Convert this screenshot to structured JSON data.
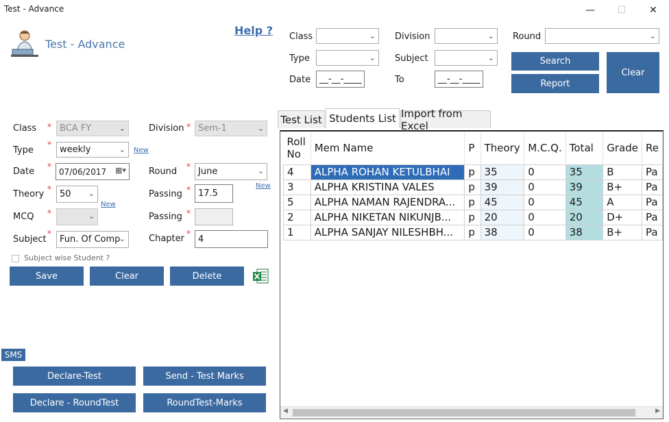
{
  "window": {
    "title": "Test - Advance",
    "minimize": "—",
    "maximize": "☐",
    "close": "✕"
  },
  "header": {
    "title": "Test - Advance",
    "help": "Help ?"
  },
  "filters": {
    "class_label": "Class",
    "division_label": "Division",
    "round_label": "Round",
    "type_label": "Type",
    "subject_label": "Subject",
    "date_label": "Date",
    "to_label": "To",
    "date_value": "__-__-____",
    "to_value": "__-__-____",
    "search": "Search",
    "report": "Report",
    "clear": "Clear"
  },
  "form": {
    "class_label": "Class",
    "class_value": "BCA FY",
    "division_label": "Division",
    "division_value": "Sem-1",
    "type_label": "Type",
    "type_value": "weekly",
    "date_label": "Date",
    "date_value": "07/06/2017",
    "round_label": "Round",
    "round_value": "June",
    "theory_label": "Theory",
    "theory_value": "50",
    "passing_label": "Passing",
    "passing_value": "17.5",
    "mcq_label": "MCQ",
    "mcq_value": "",
    "passing2_label": "Passing",
    "passing2_value": "",
    "subject_label": "Subject",
    "subject_value": "Fun. Of Comp",
    "chapter_label": "Chapter",
    "chapter_value": "4",
    "new_link": "New",
    "subject_wise": "Subject wise Student ?",
    "save": "Save",
    "clear": "Clear",
    "delete": "Delete",
    "req": "*"
  },
  "sms": {
    "label": "SMS",
    "declare_test": "Declare-Test",
    "send_test_marks": "Send - Test Marks",
    "declare_round": "Declare - RoundTest",
    "round_marks": "RoundTest-Marks"
  },
  "tabs": [
    {
      "label": "Test List"
    },
    {
      "label": "Students List"
    },
    {
      "label": "Import from Excel"
    }
  ],
  "grid": {
    "headers": {
      "roll": "Roll No",
      "name": "Mem Name",
      "p": "P",
      "theory": "Theory",
      "mcq": "M.C.Q.",
      "total": "Total",
      "grade": "Grade",
      "result": "Re"
    },
    "rows": [
      {
        "roll": "4",
        "name": "ALPHA ROHAN KETULBHAI",
        "p": "p",
        "theory": "35",
        "mcq": "0",
        "total": "35",
        "grade": "B",
        "result": "Pa"
      },
      {
        "roll": "3",
        "name": "ALPHA KRISTINA VALES",
        "p": "p",
        "theory": "39",
        "mcq": "0",
        "total": "39",
        "grade": "B+",
        "result": "Pa"
      },
      {
        "roll": "5",
        "name": "ALPHA NAMAN RAJENDRA...",
        "p": "p",
        "theory": "45",
        "mcq": "0",
        "total": "45",
        "grade": "A",
        "result": "Pa"
      },
      {
        "roll": "2",
        "name": "ALPHA NIKETAN NIKUNJB...",
        "p": "p",
        "theory": "20",
        "mcq": "0",
        "total": "20",
        "grade": "D+",
        "result": "Pa"
      },
      {
        "roll": "1",
        "name": "ALPHA SANJAY NILESHBH...",
        "p": "p",
        "theory": "38",
        "mcq": "0",
        "total": "38",
        "grade": "B+",
        "result": "Pa"
      }
    ]
  },
  "colors": {
    "accent": "#3b6aa1",
    "selection": "#2e6cb8",
    "total_cell": "#b4dde0",
    "required": "#e23b3b"
  }
}
